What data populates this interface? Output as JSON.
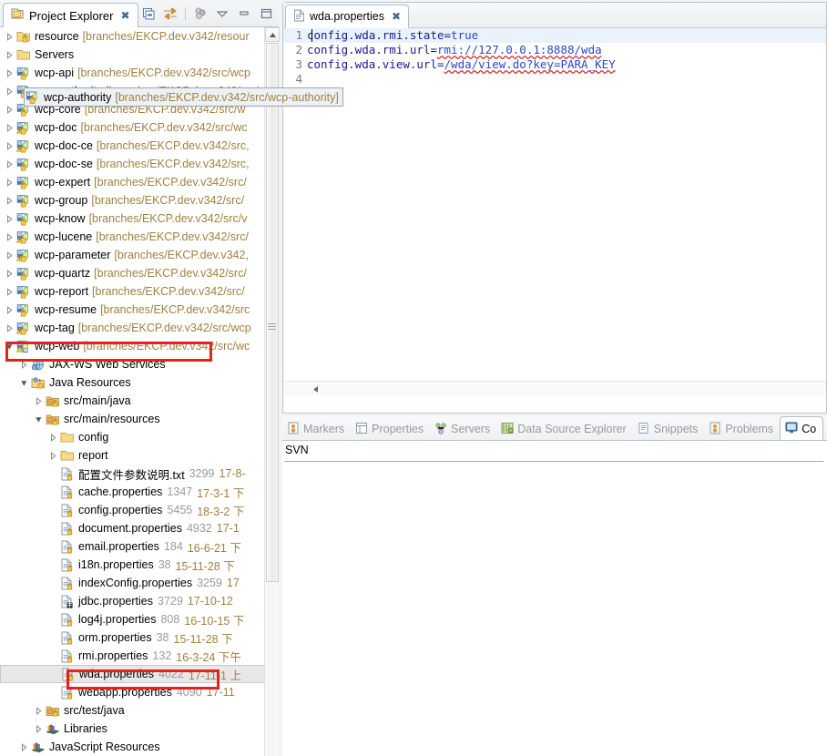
{
  "explorer": {
    "tab_title": "Project Explorer",
    "close_icon": "close-icon",
    "toolbar": [
      {
        "name": "collapse-all-icon",
        "label": "Collapse All"
      },
      {
        "name": "link-with-editor-icon",
        "label": "Link with Editor"
      },
      {
        "name": "view-filter-icon",
        "label": "Filters"
      },
      {
        "name": "view-menu-icon",
        "label": "View Menu"
      },
      {
        "name": "minimize-icon",
        "label": "Minimize"
      },
      {
        "name": "maximize-icon",
        "label": "Maximize"
      }
    ],
    "tree": [
      {
        "indent": 0,
        "twisty": "collapsed",
        "icon": "project-folder-icon",
        "label": "resource",
        "decor": "[branches/EKCP.dev.v342/resour"
      },
      {
        "indent": 0,
        "twisty": "collapsed",
        "icon": "folder-icon",
        "label": "Servers",
        "decor": ""
      },
      {
        "indent": 0,
        "twisty": "collapsed",
        "icon": "maven-project-icon",
        "label": "wcp-api",
        "decor": "[branches/EKCP.dev.v342/src/wcp"
      },
      {
        "indent": 0,
        "twisty": "collapsed",
        "icon": "maven-project-icon",
        "label": "wcp-authority",
        "decor": "[branches/EKCP.dev.v342/src/wcp-authority]",
        "selected": true
      },
      {
        "indent": 0,
        "twisty": "collapsed",
        "icon": "maven-project-icon",
        "label": "wcp-core",
        "decor": "[branches/EKCP.dev.v342/src/w"
      },
      {
        "indent": 0,
        "twisty": "collapsed",
        "icon": "maven-warn-icon",
        "label": "wcp-doc",
        "decor": "[branches/EKCP.dev.v342/src/wc"
      },
      {
        "indent": 0,
        "twisty": "collapsed",
        "icon": "maven-warn-icon",
        "label": "wcp-doc-ce",
        "decor": "[branches/EKCP.dev.v342/src,"
      },
      {
        "indent": 0,
        "twisty": "collapsed",
        "icon": "maven-project-icon",
        "label": "wcp-doc-se",
        "decor": "[branches/EKCP.dev.v342/src,"
      },
      {
        "indent": 0,
        "twisty": "collapsed",
        "icon": "maven-project-icon",
        "label": "wcp-expert",
        "decor": "[branches/EKCP.dev.v342/src/"
      },
      {
        "indent": 0,
        "twisty": "collapsed",
        "icon": "maven-project-icon",
        "label": "wcp-group",
        "decor": "[branches/EKCP.dev.v342/src/"
      },
      {
        "indent": 0,
        "twisty": "collapsed",
        "icon": "maven-project-icon",
        "label": "wcp-know",
        "decor": "[branches/EKCP.dev.v342/src/v"
      },
      {
        "indent": 0,
        "twisty": "collapsed",
        "icon": "maven-warn-icon",
        "label": "wcp-lucene",
        "decor": "[branches/EKCP.dev.v342/src/"
      },
      {
        "indent": 0,
        "twisty": "collapsed",
        "icon": "maven-warn-icon",
        "label": "wcp-parameter",
        "decor": "[branches/EKCP.dev.v342,"
      },
      {
        "indent": 0,
        "twisty": "collapsed",
        "icon": "maven-project-icon",
        "label": "wcp-quartz",
        "decor": "[branches/EKCP.dev.v342/src/"
      },
      {
        "indent": 0,
        "twisty": "collapsed",
        "icon": "maven-project-icon",
        "label": "wcp-report",
        "decor": "[branches/EKCP.dev.v342/src/"
      },
      {
        "indent": 0,
        "twisty": "collapsed",
        "icon": "maven-project-icon",
        "label": "wcp-resume",
        "decor": "[branches/EKCP.dev.v342/src"
      },
      {
        "indent": 0,
        "twisty": "collapsed",
        "icon": "maven-warn-icon",
        "label": "wcp-tag",
        "decor": "[branches/EKCP.dev.v342/src/wcp"
      },
      {
        "indent": 0,
        "twisty": "expanded",
        "icon": "maven-web-icon",
        "label": "wcp-web",
        "decor": "[branches/EKCP.dev.v342/src/wc"
      },
      {
        "indent": 1,
        "twisty": "collapsed",
        "icon": "jaxws-icon",
        "label": "JAX-WS Web Services",
        "decor": ""
      },
      {
        "indent": 1,
        "twisty": "expanded",
        "icon": "java-resources-icon",
        "label": "Java Resources",
        "decor": ""
      },
      {
        "indent": 2,
        "twisty": "collapsed",
        "icon": "source-folder-icon",
        "label": "src/main/java",
        "decor": ""
      },
      {
        "indent": 2,
        "twisty": "expanded",
        "icon": "source-folder-icon",
        "label": "src/main/resources",
        "decor": ""
      },
      {
        "indent": 3,
        "twisty": "collapsed",
        "icon": "folder-icon",
        "label": "config",
        "decor": ""
      },
      {
        "indent": 3,
        "twisty": "collapsed",
        "icon": "folder-icon",
        "label": "report",
        "decor": ""
      },
      {
        "indent": 3,
        "twisty": "none",
        "icon": "file-icon",
        "label": "配置文件参数说明.txt",
        "size": "3299",
        "date": "17-8-"
      },
      {
        "indent": 3,
        "twisty": "none",
        "icon": "file-icon",
        "label": "cache.properties",
        "size": "1347",
        "date": "17-3-1 下"
      },
      {
        "indent": 3,
        "twisty": "none",
        "icon": "file-icon",
        "label": "config.properties",
        "size": "5455",
        "date": "18-3-2 下"
      },
      {
        "indent": 3,
        "twisty": "none",
        "icon": "file-icon",
        "label": "document.properties",
        "size": "4932",
        "date": "17-1"
      },
      {
        "indent": 3,
        "twisty": "none",
        "icon": "file-icon",
        "label": "email.properties",
        "size": "184",
        "date": "16-6-21 下"
      },
      {
        "indent": 3,
        "twisty": "none",
        "icon": "file-icon",
        "label": "i18n.properties",
        "size": "38",
        "date": "15-11-28 下"
      },
      {
        "indent": 3,
        "twisty": "none",
        "icon": "file-icon",
        "label": "indexConfig.properties",
        "size": "3259",
        "date": "17"
      },
      {
        "indent": 3,
        "twisty": "none",
        "icon": "file-modified-icon",
        "label": "jdbc.properties",
        "size": "3729",
        "date": "17-10-12"
      },
      {
        "indent": 3,
        "twisty": "none",
        "icon": "file-icon",
        "label": "log4j.properties",
        "size": "808",
        "date": "16-10-15 下"
      },
      {
        "indent": 3,
        "twisty": "none",
        "icon": "file-icon",
        "label": "orm.properties",
        "size": "38",
        "date": "15-11-28 下"
      },
      {
        "indent": 3,
        "twisty": "none",
        "icon": "file-icon",
        "label": "rmi.properties",
        "size": "132",
        "date": "16-3-24 下午"
      },
      {
        "indent": 3,
        "twisty": "none",
        "icon": "file-icon",
        "label": "wda.properties",
        "size": "4022",
        "date": "17-11-1 上",
        "selected": true
      },
      {
        "indent": 3,
        "twisty": "none",
        "icon": "file-icon",
        "label": "webapp.properties",
        "size": "4090",
        "date": "17-11"
      },
      {
        "indent": 2,
        "twisty": "collapsed",
        "icon": "source-folder-icon",
        "label": "src/test/java",
        "decor": ""
      },
      {
        "indent": 2,
        "twisty": "collapsed",
        "icon": "libraries-icon",
        "label": "Libraries",
        "decor": ""
      },
      {
        "indent": 1,
        "twisty": "collapsed",
        "icon": "libraries-icon",
        "label": "JavaScript Resources",
        "decor": ""
      }
    ],
    "scrollbar": {
      "name": "tree-vertical-scrollbar"
    }
  },
  "editor": {
    "tab_title": "wda.properties",
    "tab_icon": "properties-file-icon",
    "close_icon": "close-icon",
    "lines": [
      {
        "num": "1",
        "key": "config.wda.rmi.state=",
        "value": "true",
        "current": true
      },
      {
        "num": "2",
        "key": "config.wda.rmi.url=",
        "value": "rmi://127.0.0.1:8888/wda",
        "current": false
      },
      {
        "num": "3",
        "key": "config.wda.view.url=",
        "value": "/wda/view.do?key=PARA_KEY",
        "current": false
      },
      {
        "num": "4",
        "key": "",
        "value": "",
        "current": false
      }
    ],
    "hscroll_left_icon": "scroll-left-icon"
  },
  "bottom_panel": {
    "tabs": [
      {
        "label": "Markers",
        "icon": "markers-icon",
        "active": false
      },
      {
        "label": "Properties",
        "icon": "properties-icon",
        "active": false
      },
      {
        "label": "Servers",
        "icon": "servers-icon",
        "active": false
      },
      {
        "label": "Data Source Explorer",
        "icon": "data-source-icon",
        "active": false
      },
      {
        "label": "Snippets",
        "icon": "snippets-icon",
        "active": false
      },
      {
        "label": "Problems",
        "icon": "problems-icon",
        "active": false
      },
      {
        "label": "Co",
        "icon": "console-icon",
        "active": true
      }
    ],
    "content_label": "SVN"
  },
  "annotations": [
    {
      "name": "redbox-wcp-web"
    },
    {
      "name": "redbox-wda-properties"
    }
  ],
  "colors": {
    "accent_red": "#e8211a",
    "decor_text": "#a08040",
    "selected_row": "#e8e8e8",
    "current_line": "#eaf2fb"
  }
}
